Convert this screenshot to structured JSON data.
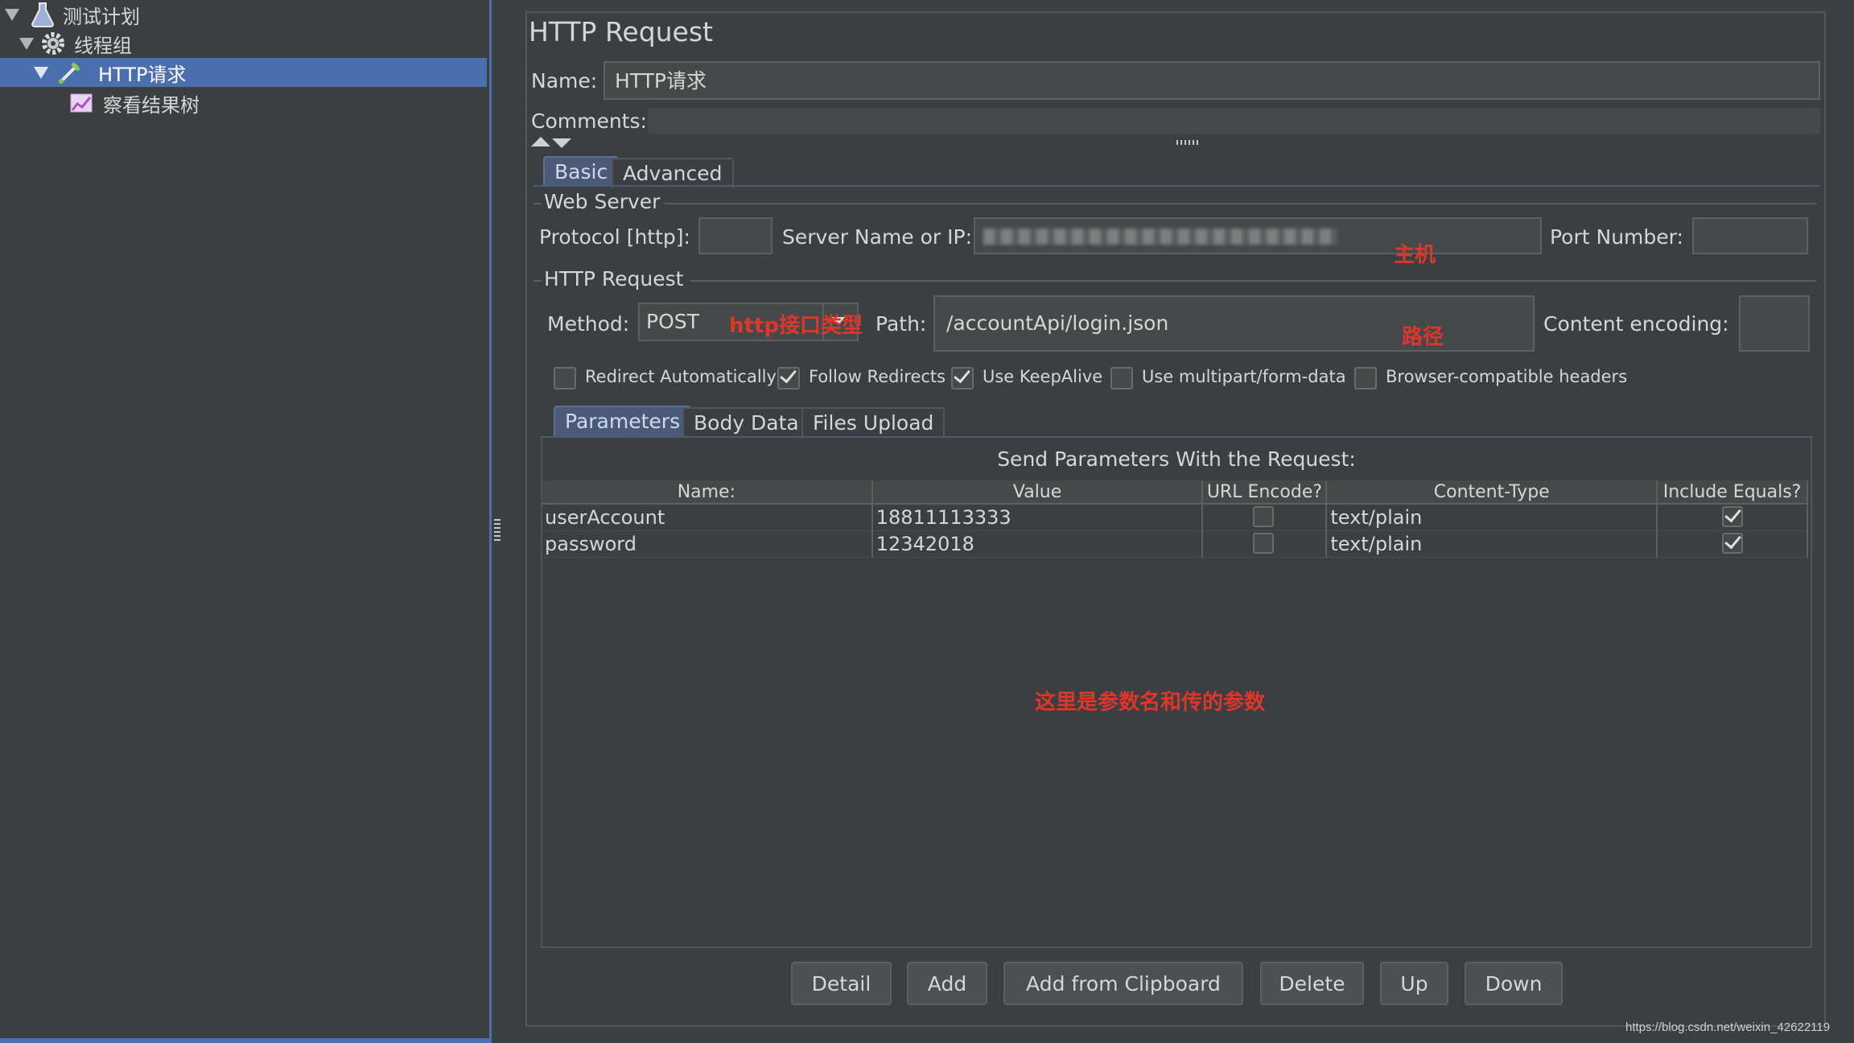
{
  "tree": {
    "items": [
      {
        "label": "测试计划"
      },
      {
        "label": "线程组"
      },
      {
        "label": "HTTP请求"
      },
      {
        "label": "察看结果树"
      }
    ]
  },
  "panel": {
    "title": "HTTP Request",
    "name_label": "Name:",
    "name_value": "HTTP请求",
    "comments_label": "Comments:",
    "tabs": [
      {
        "label": "Basic"
      },
      {
        "label": "Advanced"
      }
    ],
    "web_server": {
      "title": "Web Server",
      "protocol_label": "Protocol [http]:",
      "server_label": "Server Name or IP:",
      "port_label": "Port Number:"
    },
    "http_request": {
      "title": "HTTP Request",
      "method_label": "Method:",
      "method_value": "POST",
      "path_label": "Path:",
      "path_value": "/accountApi/login.json",
      "encoding_label": "Content encoding:"
    },
    "options": [
      {
        "label": "Redirect Automatically",
        "checked": false
      },
      {
        "label": "Follow Redirects",
        "checked": true
      },
      {
        "label": "Use KeepAlive",
        "checked": true
      },
      {
        "label": "Use multipart/form-data",
        "checked": false
      },
      {
        "label": "Browser-compatible headers",
        "checked": false
      }
    ],
    "sub_tabs": [
      {
        "label": "Parameters"
      },
      {
        "label": "Body Data"
      },
      {
        "label": "Files Upload"
      }
    ],
    "params_title": "Send Parameters With the Request:",
    "columns": [
      "Name:",
      "Value",
      "URL Encode?",
      "Content-Type",
      "Include Equals?"
    ],
    "rows": [
      {
        "name": "userAccount",
        "value": "18811113333",
        "url_encode": false,
        "content_type": "text/plain",
        "include_equals": true
      },
      {
        "name": "password",
        "value": "12342018",
        "url_encode": false,
        "content_type": "text/plain",
        "include_equals": true
      }
    ],
    "buttons": [
      "Detail",
      "Add",
      "Add from Clipboard",
      "Delete",
      "Up",
      "Down"
    ]
  },
  "annotations": {
    "host": "主机",
    "method": "http接口类型",
    "path": "路径",
    "params": "这里是参数名和传的参数"
  },
  "watermark": "https://blog.csdn.net/weixin_42622119",
  "colors": {
    "background": "#3c3f41",
    "selection": "#4b6eaf",
    "annotation": "#e0352b"
  }
}
